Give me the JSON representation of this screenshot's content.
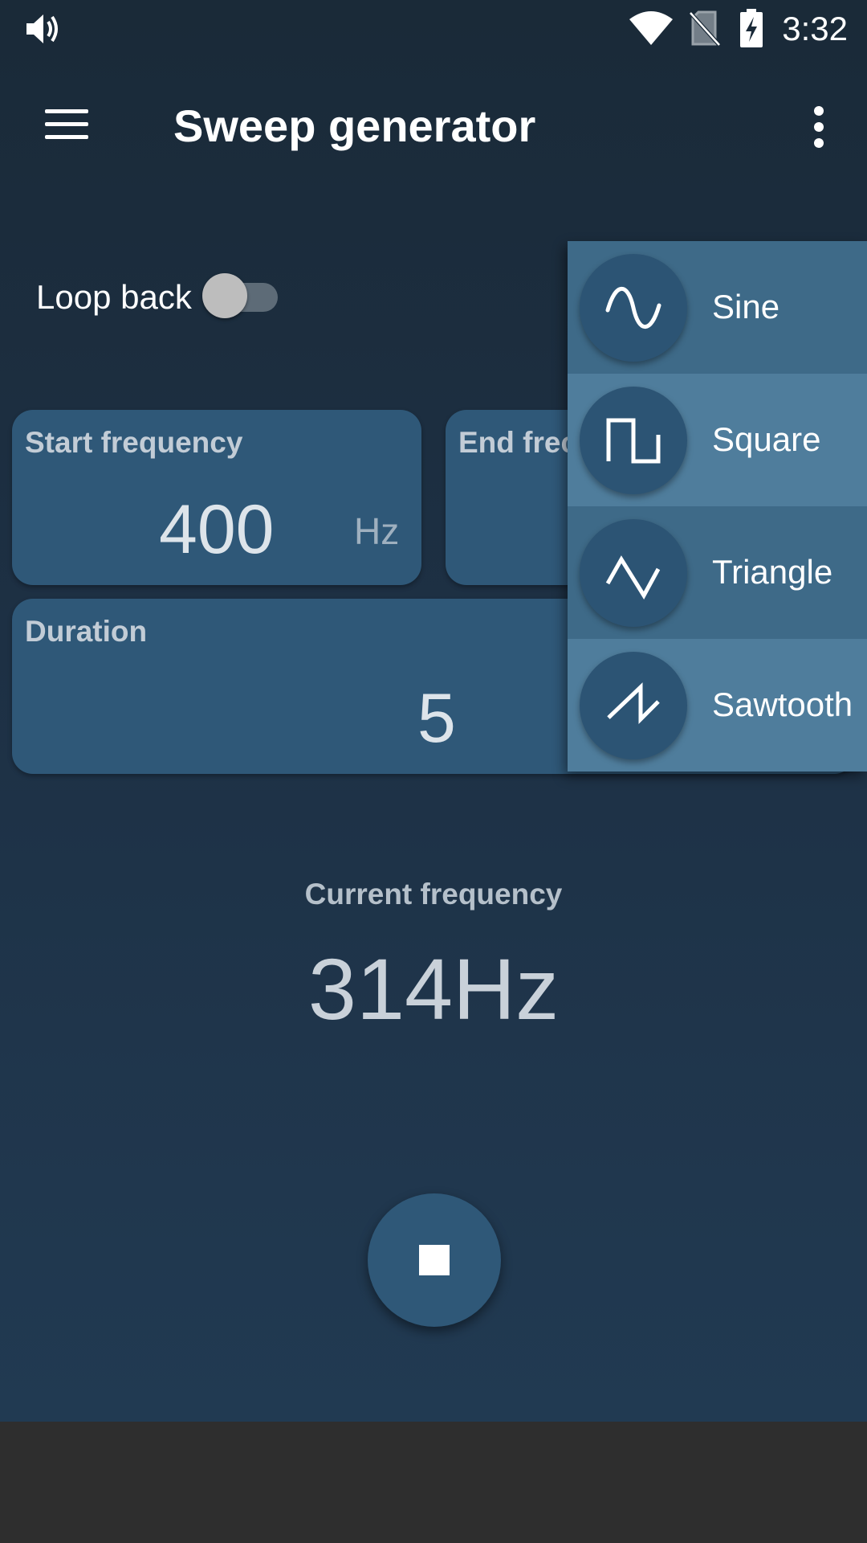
{
  "status_bar": {
    "time": "3:32",
    "icons": [
      "volume-icon",
      "wifi-icon",
      "no-sim-icon",
      "battery-charging-icon"
    ]
  },
  "toolbar": {
    "title": "Sweep generator",
    "menu_icon": "hamburger-menu-icon",
    "overflow_icon": "more-vert-icon"
  },
  "loop_back": {
    "label": "Loop back",
    "enabled": false
  },
  "start_frequency": {
    "label": "Start frequency",
    "value": "400",
    "unit": "Hz"
  },
  "end_frequency": {
    "label": "End frec"
  },
  "duration": {
    "label": "Duration",
    "value": "5"
  },
  "current": {
    "label": "Current frequency",
    "value": "314Hz"
  },
  "fab": {
    "icon": "stop-icon"
  },
  "waveform_menu": {
    "items": [
      {
        "label": "Sine",
        "icon": "sine-wave-icon"
      },
      {
        "label": "Square",
        "icon": "square-wave-icon"
      },
      {
        "label": "Triangle",
        "icon": "triangle-wave-icon"
      },
      {
        "label": "Sawtooth",
        "icon": "sawtooth-wave-icon"
      }
    ]
  },
  "colors": {
    "background_top": "#1a2a38",
    "card": "#2f5878",
    "menu_item_a": "#3e6a88",
    "menu_item_b": "#4f7d9c",
    "nav_bar": "#2e2e2e"
  }
}
